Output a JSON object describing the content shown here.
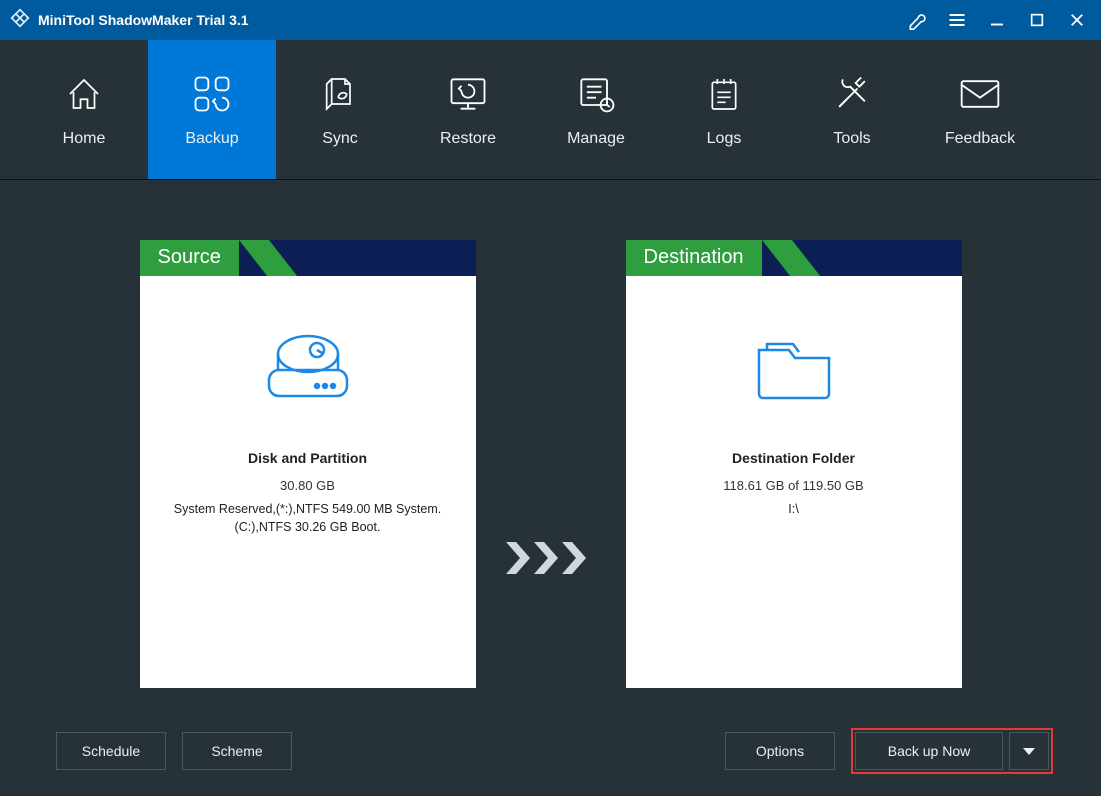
{
  "titlebar": {
    "app_title": "MiniTool ShadowMaker Trial 3.1"
  },
  "nav": {
    "items": [
      {
        "label": "Home"
      },
      {
        "label": "Backup"
      },
      {
        "label": "Sync"
      },
      {
        "label": "Restore"
      },
      {
        "label": "Manage"
      },
      {
        "label": "Logs"
      },
      {
        "label": "Tools"
      },
      {
        "label": "Feedback"
      }
    ],
    "active_index": 1
  },
  "source_card": {
    "tab_label": "Source",
    "title": "Disk and Partition",
    "size": "30.80 GB",
    "detail": "System Reserved,(*:),NTFS 549.00 MB System. (C:),NTFS 30.26 GB Boot."
  },
  "destination_card": {
    "tab_label": "Destination",
    "title": "Destination Folder",
    "size": "118.61 GB of 119.50 GB",
    "detail": "I:\\"
  },
  "buttons": {
    "schedule": "Schedule",
    "scheme": "Scheme",
    "options": "Options",
    "backup_now": "Back up Now"
  }
}
